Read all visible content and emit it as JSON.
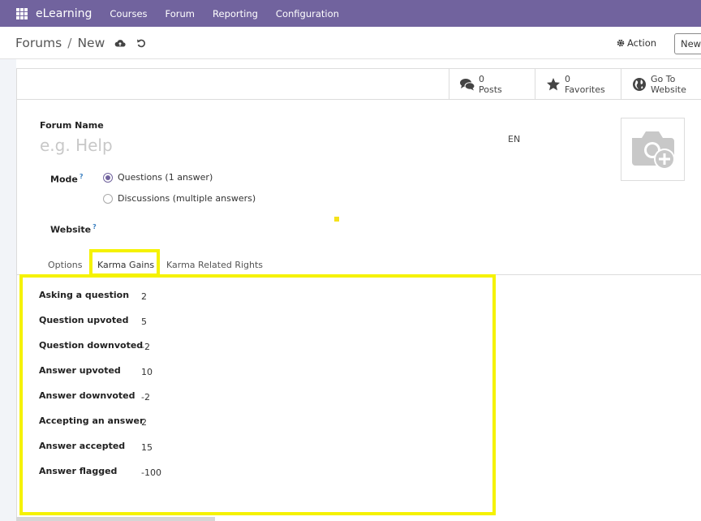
{
  "navbar": {
    "app_name": "eLearning",
    "menu": [
      "Courses",
      "Forum",
      "Reporting",
      "Configuration"
    ],
    "color": "#71639e"
  },
  "control_panel": {
    "breadcrumb_parent": "Forums",
    "breadcrumb_sep": "/",
    "breadcrumb_current": "New",
    "action_label": "Action",
    "new_label": "New",
    "save_icon": "cloud-upload-icon",
    "discard_icon": "undo-icon"
  },
  "stat_buttons": [
    {
      "value": "0",
      "label": "Posts",
      "icon": "comments-icon"
    },
    {
      "value": "0",
      "label": "Favorites",
      "icon": "star-icon"
    },
    {
      "value": "Go To",
      "label": "Website",
      "icon": "globe-icon"
    }
  ],
  "form": {
    "name_label": "Forum Name",
    "name_placeholder": "e.g. Help",
    "lang": "EN",
    "mode_label": "Mode",
    "help_mark": "?",
    "mode_options": [
      {
        "label": "Questions (1 answer)",
        "checked": true
      },
      {
        "label": "Discussions (multiple answers)",
        "checked": false
      }
    ],
    "website_label": "Website",
    "image_icon": "camera-add-icon"
  },
  "tabs": [
    "Options",
    "Karma Gains",
    "Karma Related Rights"
  ],
  "active_tab": "Karma Gains",
  "karma_gains": [
    {
      "label": "Asking a question",
      "value": "2"
    },
    {
      "label": "Question upvoted",
      "value": "5"
    },
    {
      "label": "Question downvoted",
      "value": "-2"
    },
    {
      "label": "Answer upvoted",
      "value": "10"
    },
    {
      "label": "Answer downvoted",
      "value": "-2"
    },
    {
      "label": "Accepting an answer",
      "value": "2"
    },
    {
      "label": "Answer accepted",
      "value": "15"
    },
    {
      "label": "Answer flagged",
      "value": "-100"
    }
  ],
  "highlight_color": "#f5f200"
}
